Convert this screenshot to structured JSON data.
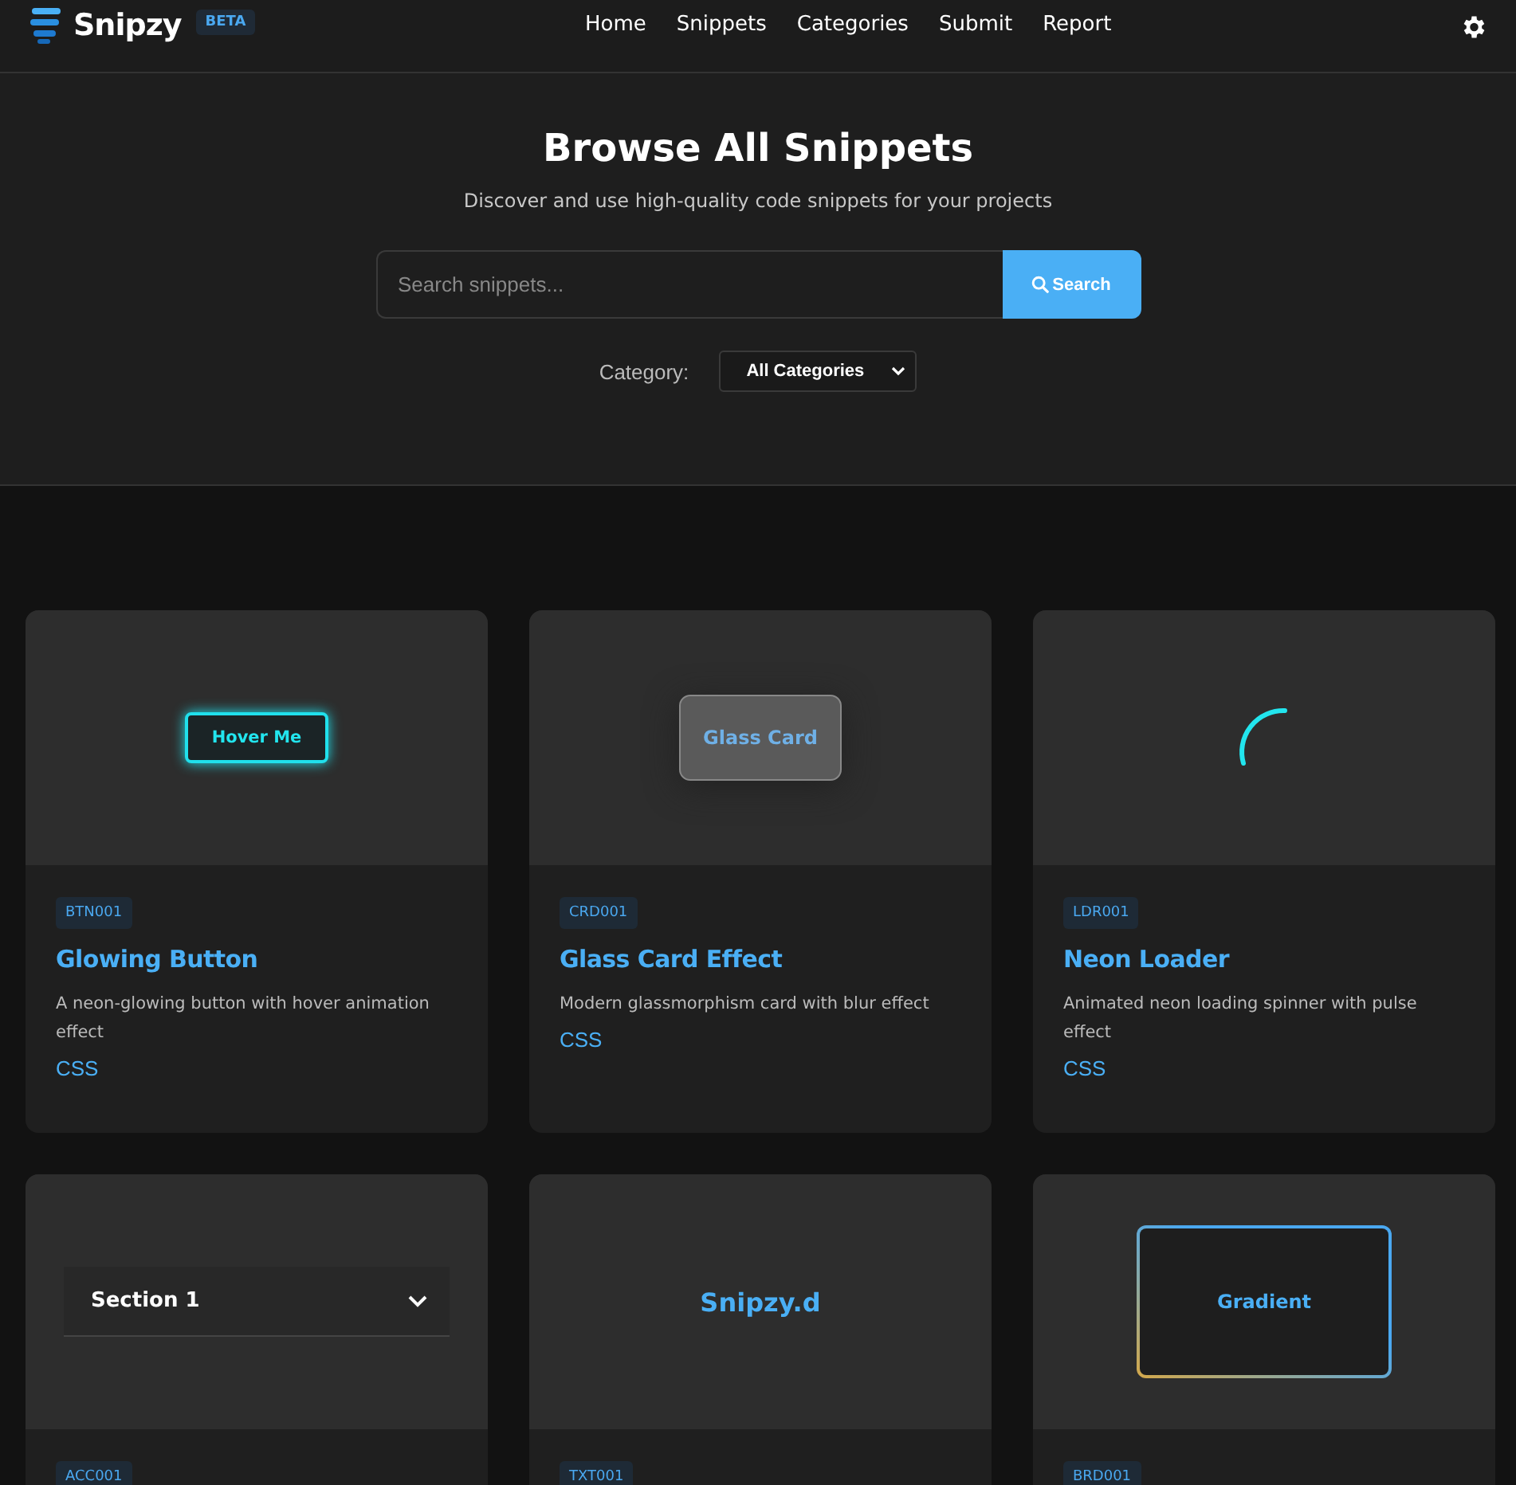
{
  "header": {
    "brand": "Snipzy",
    "badge": "BETA",
    "nav": [
      {
        "label": "Home"
      },
      {
        "label": "Snippets"
      },
      {
        "label": "Categories"
      },
      {
        "label": "Submit"
      },
      {
        "label": "Report"
      }
    ]
  },
  "hero": {
    "title": "Browse All Snippets",
    "subtitle": "Discover and use high-quality code snippets for your projects",
    "search": {
      "placeholder": "Search snippets...",
      "button": "Search"
    },
    "category": {
      "label": "Category:",
      "value": "All Categories"
    }
  },
  "cards": [
    {
      "kind": "glow-button",
      "preview_text": "Hover Me",
      "code": "BTN001",
      "title": "Glowing Button",
      "description": "A neon-glowing button with hover animation effect",
      "language": "CSS"
    },
    {
      "kind": "glass-card",
      "preview_text": "Glass Card",
      "code": "CRD001",
      "title": "Glass Card Effect",
      "description": "Modern glassmorphism card with blur effect",
      "language": "CSS"
    },
    {
      "kind": "spinner",
      "code": "LDR001",
      "title": "Neon Loader",
      "description": "Animated neon loading spinner with pulse effect",
      "language": "CSS"
    },
    {
      "kind": "accordion",
      "preview_text": "Section 1",
      "code": "ACC001"
    },
    {
      "kind": "text",
      "preview_text": "Snipzy.d",
      "code": "TXT001"
    },
    {
      "kind": "gradient-border",
      "preview_text": "Gradient",
      "code": "BRD001"
    }
  ]
}
